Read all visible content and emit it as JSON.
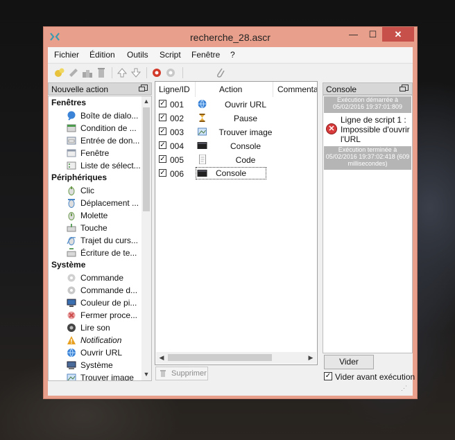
{
  "window": {
    "title": "recherche_28.ascr",
    "minimize": "—",
    "maximize": "☐",
    "close": "✕"
  },
  "menu": [
    "Fichier",
    "Édition",
    "Outils",
    "Script",
    "Fenêtre",
    "?"
  ],
  "left_panel": {
    "title": "Nouvelle action",
    "categories": [
      {
        "label": "Fenêtres",
        "items": [
          {
            "label": "Boîte de dialo...",
            "icon": "dialog-box-icon",
            "color": "#3b83d6"
          },
          {
            "label": "Condition de ...",
            "icon": "window-condition-icon",
            "color": "#4c9a4c"
          },
          {
            "label": "Entrée de don...",
            "icon": "data-entry-icon",
            "color": "#7a8aa0"
          },
          {
            "label": "Fenêtre",
            "icon": "window-icon",
            "color": "#8c97a8"
          },
          {
            "label": "Liste de sélect...",
            "icon": "selection-list-icon",
            "color": "#6aa86a"
          }
        ]
      },
      {
        "label": "Périphériques",
        "items": [
          {
            "label": "Clic",
            "icon": "mouse-click-icon",
            "color": "#6a9a4a"
          },
          {
            "label": "Déplacement ...",
            "icon": "mouse-move-icon",
            "color": "#4a86c6"
          },
          {
            "label": "Molette",
            "icon": "mouse-wheel-icon",
            "color": "#6a9a4a"
          },
          {
            "label": "Touche",
            "icon": "keyboard-key-icon",
            "color": "#5f9f5f"
          },
          {
            "label": "Trajet du curs...",
            "icon": "cursor-path-icon",
            "color": "#4a86c6"
          },
          {
            "label": "Écriture de te...",
            "icon": "text-writing-icon",
            "color": "#5f9f5f"
          }
        ]
      },
      {
        "label": "Système",
        "items": [
          {
            "label": "Commande",
            "icon": "command-icon",
            "color": "#b8b8b8"
          },
          {
            "label": "Commande d...",
            "icon": "command-gear-icon",
            "color": "#b8b8b8"
          },
          {
            "label": "Couleur de pi...",
            "icon": "pixel-color-icon",
            "color": "#3a6fb0"
          },
          {
            "label": "Fermer proce...",
            "icon": "close-process-icon",
            "color": "#cc4a4a"
          },
          {
            "label": "Lire son",
            "icon": "sound-icon",
            "color": "#444444"
          },
          {
            "label": "Notification",
            "icon": "warning-icon",
            "color": "#e8a020",
            "italic": true
          },
          {
            "label": "Ouvrir URL",
            "icon": "globe-icon",
            "color": "#3b83d6"
          },
          {
            "label": "Système",
            "icon": "computer-icon",
            "color": "#4a6a9a"
          },
          {
            "label": "Trouver image",
            "icon": "find-image-icon",
            "color": "#5a8ac0"
          }
        ]
      }
    ]
  },
  "script_list": {
    "columns": [
      "Ligne/ID",
      "Action",
      "Commentai"
    ],
    "rows": [
      {
        "id": "001",
        "action": "Ouvrir URL",
        "icon": "globe-icon",
        "color": "#3b83d6"
      },
      {
        "id": "002",
        "action": "Pause",
        "icon": "hourglass-icon",
        "color": "#c88a20"
      },
      {
        "id": "003",
        "action": "Trouver image",
        "icon": "find-image-icon",
        "color": "#5a8ac0"
      },
      {
        "id": "004",
        "action": "Console",
        "icon": "console-icon",
        "color": "#222222"
      },
      {
        "id": "005",
        "action": "Code",
        "icon": "code-icon",
        "color": "#9a9a9a"
      },
      {
        "id": "006",
        "action": "Console",
        "icon": "console-icon",
        "color": "#222222"
      }
    ],
    "delete_button": "Supprimer"
  },
  "console_panel": {
    "title": "Console",
    "log_start": "Exécution démarrée à 05/02/2016 19:37:01:809",
    "log_error": "Ligne de script 1 : Impossible d'ouvrir l'URL",
    "log_end": "Exécution terminée à 05/02/2016 19:37:02:418 (609 millisecondes)",
    "clear_button": "Vider",
    "clear_before_label": "Vider avant exécution"
  },
  "checkmark": "✓",
  "colors": {
    "window_frame": "#e8a08c",
    "close_button": "#c7514a",
    "log_info_bg": "#b5b5b5"
  }
}
